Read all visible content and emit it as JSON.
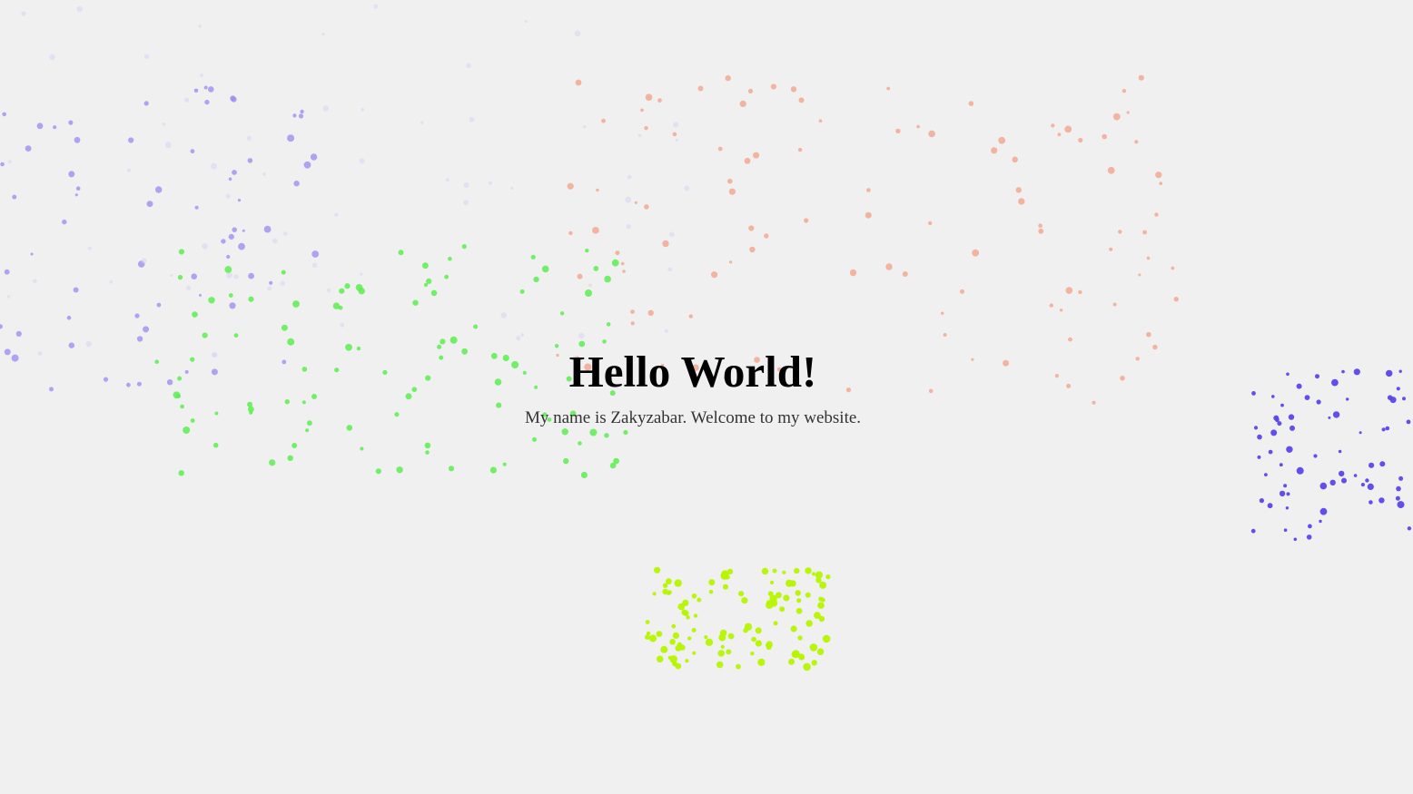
{
  "hero": {
    "title": "Hello World!",
    "subtitle": "My name is Zakyzabar. Welcome to my website."
  },
  "theme": {
    "background": "#f0f0f0",
    "title_color": "#000000",
    "subtitle_color": "#333333"
  },
  "particle_clusters": [
    {
      "name": "lavender-cluster",
      "color": "#9b88f0"
    },
    {
      "name": "pale-lavender-cluster",
      "color": "#d9d4f2"
    },
    {
      "name": "salmon-cluster",
      "color": "#f3a48c"
    },
    {
      "name": "green-cluster",
      "color": "#5bef4f"
    },
    {
      "name": "violet-cluster",
      "color": "#5a45ec"
    },
    {
      "name": "lime-cluster",
      "color": "#b6f500"
    }
  ]
}
